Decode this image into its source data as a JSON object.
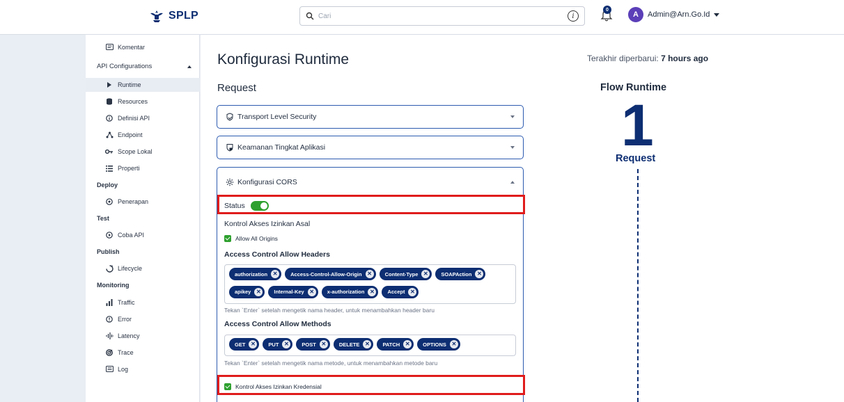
{
  "header": {
    "logo_text": "SPLP",
    "search_placeholder": "Cari",
    "notification_count": "0",
    "avatar_initial": "A",
    "user_name": "Admin@Arn.Go.Id"
  },
  "sidebar": {
    "komentar": "Komentar",
    "api_config": "API Configurations",
    "runtime": "Runtime",
    "resources": "Resources",
    "definisi_api": "Definisi API",
    "endpoint": "Endpoint",
    "scope_lokal": "Scope Lokal",
    "properti": "Properti",
    "deploy": "Deploy",
    "penerapan": "Penerapan",
    "test": "Test",
    "coba_api": "Coba API",
    "publish": "Publish",
    "lifecycle": "Lifecycle",
    "monitoring": "Monitoring",
    "traffic": "Traffic",
    "error": "Error",
    "latency": "Latency",
    "trace": "Trace",
    "log": "Log"
  },
  "main": {
    "title": "Konfigurasi Runtime",
    "section": "Request",
    "panel_tls": "Transport Level Security",
    "panel_app_security": "Keamanan Tingkat Aplikasi",
    "panel_cors": "Konfigurasi CORS",
    "status_label": "Status",
    "status_enabled": true,
    "allow_origin_label": "Kontrol Akses Izinkan Asal",
    "allow_all_origins": "Allow All Origins",
    "allow_headers_label": "Access Control Allow Headers",
    "headers": [
      "authorization",
      "Access-Control-Allow-Origin",
      "Content-Type",
      "SOAPAction",
      "apikey",
      "Internal-Key",
      "x-authorization",
      "Accept"
    ],
    "headers_hint": "Tekan `Enter` setelah mengetik nama header, untuk menambahkan header baru",
    "allow_methods_label": "Access Control Allow Methods",
    "methods": [
      "GET",
      "PUT",
      "POST",
      "DELETE",
      "PATCH",
      "OPTIONS"
    ],
    "methods_hint": "Tekan `Enter` setelah mengetik nama metode, untuk menambahkan metode baru",
    "credentials_label": "Kontrol Akses Izinkan Kredensial"
  },
  "flow": {
    "updated_prefix": "Terakhir diperbarui:",
    "updated_value": "7 hours ago",
    "title": "Flow Runtime",
    "number": "1",
    "label": "Request"
  },
  "colors": {
    "brand": "#0d2e72",
    "accent_border": "#2d5bb0",
    "toggle_on": "#2ea02e",
    "highlight": "#e01c1c"
  }
}
